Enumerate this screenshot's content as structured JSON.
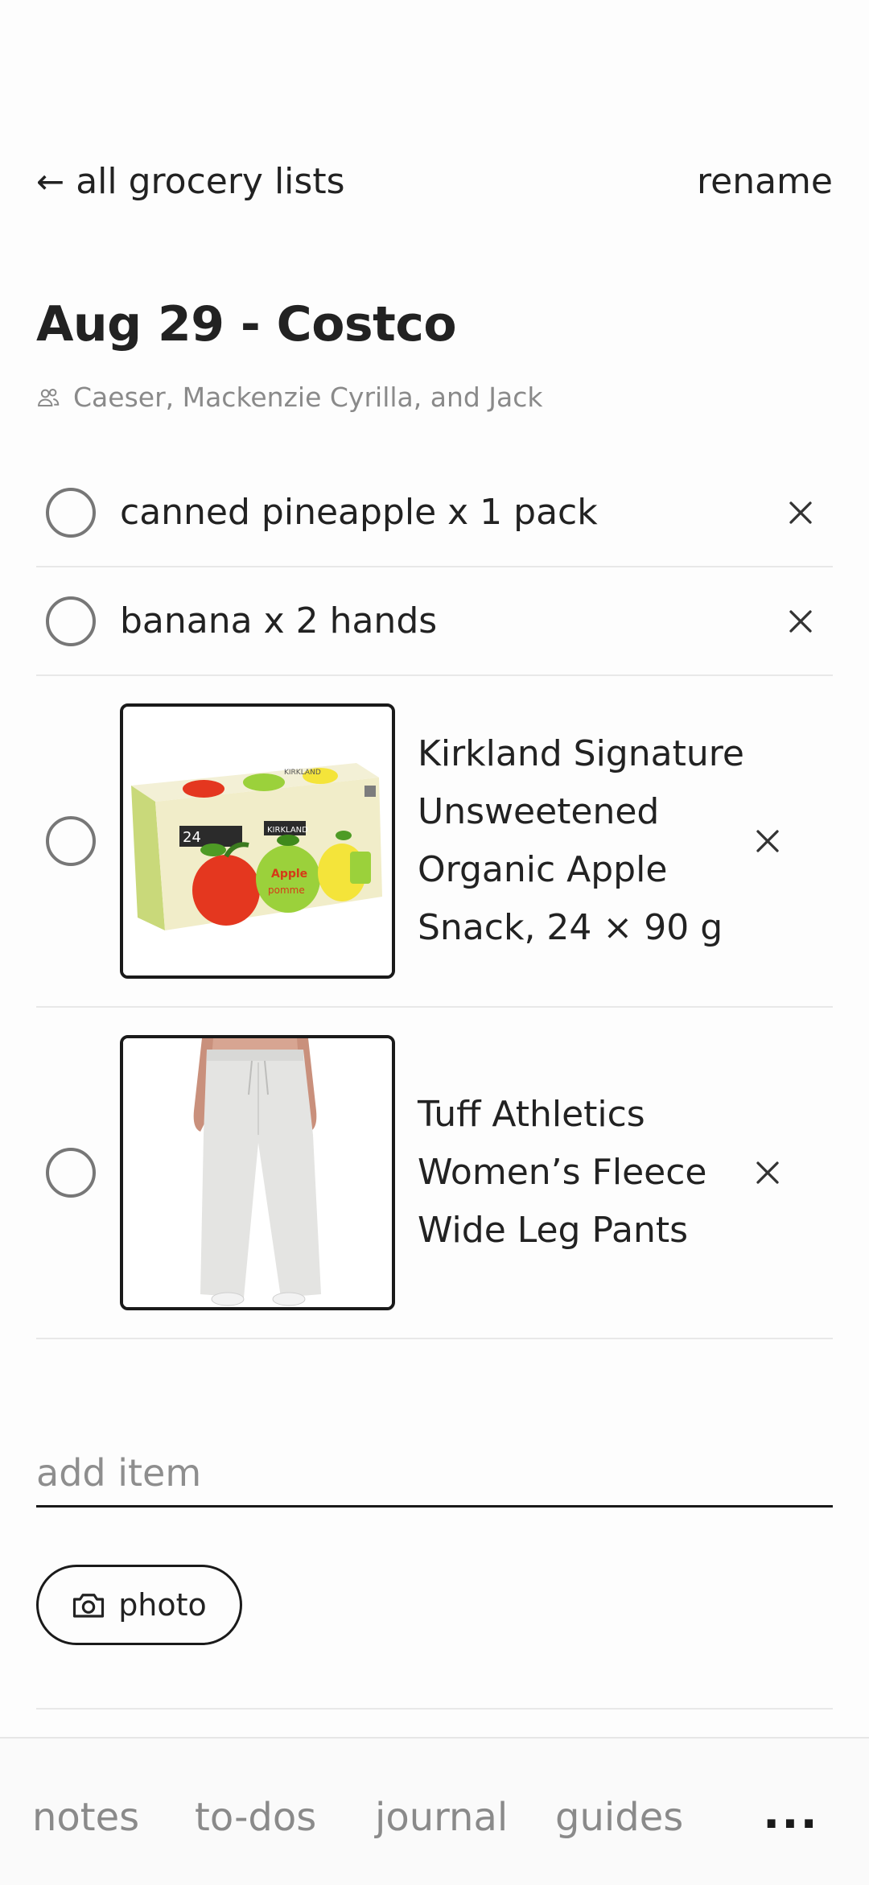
{
  "header": {
    "back_label": "all grocery lists",
    "back_arrow": "←",
    "rename_label": "rename"
  },
  "list": {
    "title": "Aug 29 - Costco",
    "members": "Caeser, Mackenzie Cyrilla, and Jack",
    "items": [
      {
        "label": "canned pineapple x 1 pack",
        "checked": false
      },
      {
        "label": "banana x 2 hands",
        "checked": false
      },
      {
        "label": "Kirkland Signature Unsweetened Organic Apple Snack, 24 × 90 g",
        "checked": false,
        "image": "apple-snack-box"
      },
      {
        "label": "Tuff Athletics Women’s Fleece Wide Leg Pants",
        "checked": false,
        "image": "fleece-pants"
      }
    ]
  },
  "add_item": {
    "placeholder": "add item"
  },
  "photo_button": {
    "label": "photo",
    "icon": "camera-icon"
  },
  "thumb_text": {
    "count": "24",
    "brand1": "KIRKLAND",
    "brand2": "KIRKLAND",
    "apple": "Apple",
    "pomme": "pomme"
  },
  "bottom_nav": {
    "items": [
      "notes",
      "to-dos",
      "journal",
      "guides"
    ],
    "more": "..."
  },
  "colors": {
    "text": "#222222",
    "muted": "#8a8a8a",
    "border": "#1a1a1a",
    "divider": "#e8e8e8"
  }
}
